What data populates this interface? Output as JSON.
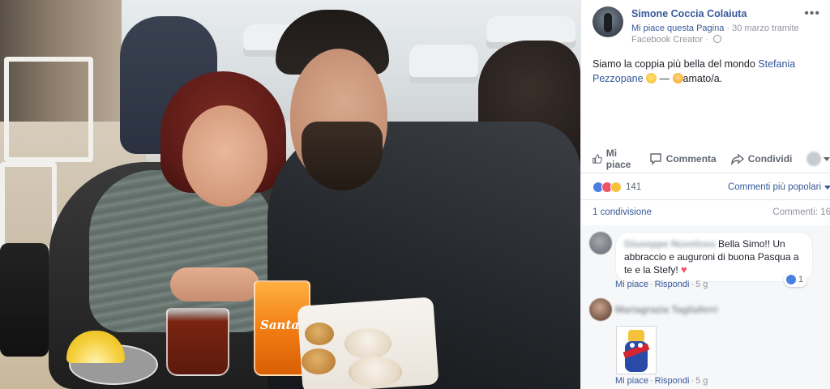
{
  "post": {
    "page_name": "Simone Coccia Colaiuta",
    "like_page": "Mi piace questa Pagina",
    "meta_rest": " · 30 marzo tramite",
    "meta_line2": "Facebook Creator · ",
    "text_main": "Siamo la coppia più bella del mondo ",
    "text_tag": "Stefania Pezzopane",
    "text_tail": " — ",
    "text_feeling": "amato/a."
  },
  "actions": {
    "like": "Mi piace",
    "comment": "Commenta",
    "share": "Condividi"
  },
  "reactions": {
    "count": "141",
    "sort_label": "Commenti più popolari"
  },
  "stats": {
    "shares": "1 condivisione",
    "comments": "Commenti: 16"
  },
  "comments": [
    {
      "author_blurred": "Giuseppe Nuvoloso",
      "text_a": "Bella Simo!! Un abbraccio e auguroni di buona Pasqua a te e la Stefy! ",
      "likes": "1",
      "like_label": "Mi piace",
      "reply_label": "Rispondi",
      "time": "5 g"
    },
    {
      "author_blurred": "Mariagrazia Tagliaferri",
      "like_label": "Mi piace",
      "reply_label": "Rispondi",
      "time": "5 g"
    }
  ],
  "photo": {
    "cup_brand": "Santal"
  },
  "colors": {
    "link": "#365899",
    "muted": "#90949c",
    "like_blue": "#4a7fe3",
    "love_red": "#f25268"
  },
  "icons": [
    "more-options-icon",
    "globe-icon",
    "thumbs-up-icon",
    "comment-bubble-icon",
    "share-arrow-icon",
    "chevron-down-icon",
    "heart-icon"
  ]
}
